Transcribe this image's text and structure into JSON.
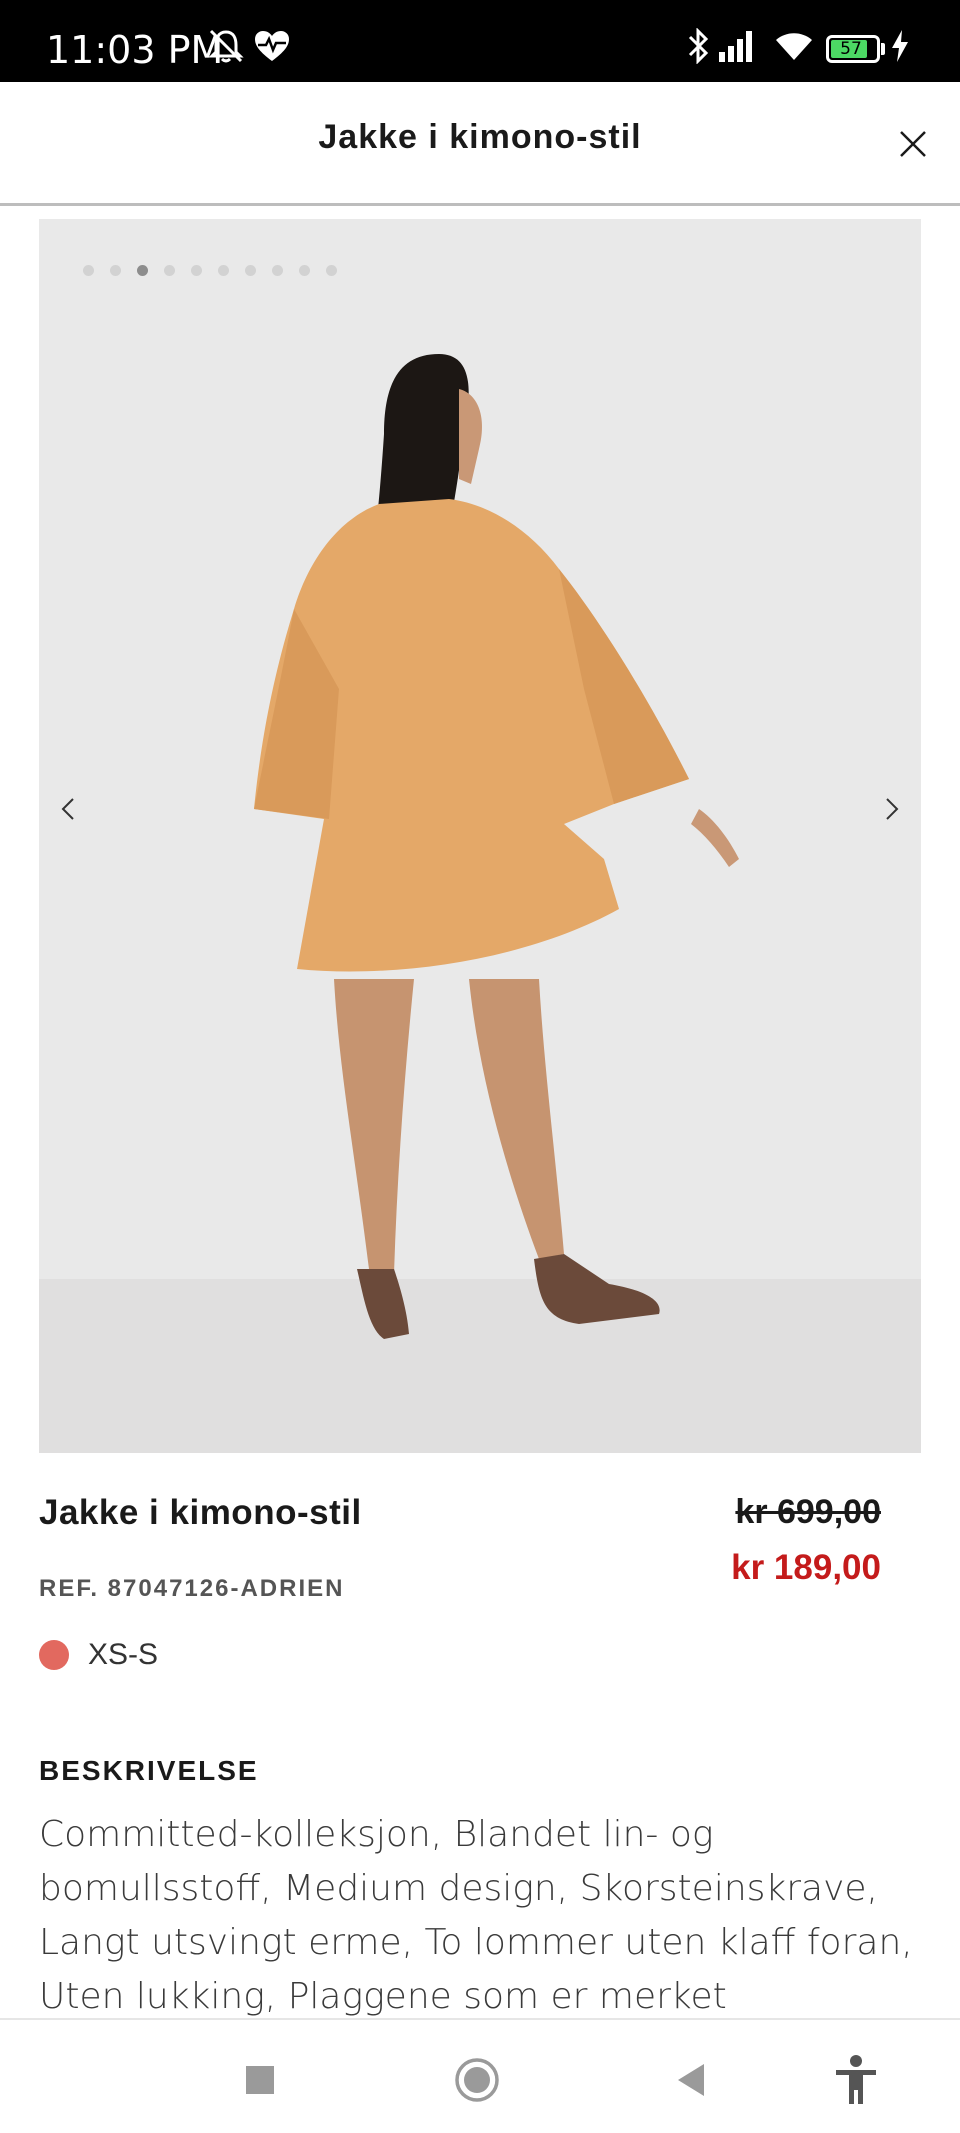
{
  "status_bar": {
    "time": "11:03 PM",
    "battery_level": "57",
    "icons": [
      "bell-off-icon",
      "heart-pulse-icon",
      "bluetooth-icon",
      "signal-icon",
      "wifi-icon",
      "battery-icon",
      "charging-icon"
    ]
  },
  "header": {
    "title": "Jakke i kimono-stil",
    "close_icon": "close-icon"
  },
  "gallery": {
    "image_count": 10,
    "active_index": 2,
    "prev_icon": "chevron-left-icon",
    "next_icon": "chevron-right-icon"
  },
  "product": {
    "name": "Jakke i kimono-stil",
    "price_original": "kr 699,00",
    "price_sale": "kr 189,00",
    "reference": "REF. 87047126-ADRIEN",
    "color_hex": "#e2695f",
    "size": "XS-S"
  },
  "description": {
    "heading": "BESKRIVELSE",
    "text": "Committed-kolleksjon, Blandet lin- og bomullsstoff, Medium design, Skorsteinskrave, Langt utsvingt erme, To lommer uten klaff foran, Uten lukking, Plaggene som er merket"
  },
  "colors": {
    "sale_price": "#c41b1b",
    "header_divider": "#bdbdbd"
  },
  "nav_bar": {
    "icons": [
      "recents-icon",
      "home-icon",
      "back-icon",
      "accessibility-icon"
    ]
  }
}
